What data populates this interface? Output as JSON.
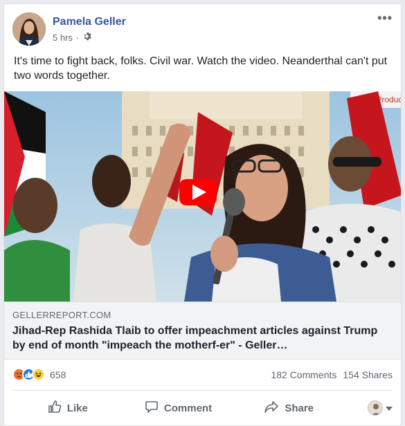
{
  "post": {
    "author": "Pamela Geller",
    "time": "5 hrs",
    "privacy_icon": "gear-icon",
    "text": "It's time to fight back, folks. Civil war. Watch the video. Neanderthal can't put two words together."
  },
  "media": {
    "watermark": "vald Production",
    "play_icon": "youtube-play-icon"
  },
  "link": {
    "domain": "GELLERREPORT.COM",
    "headline": "Jihad-Rep Rashida Tlaib to offer impeachment articles against Trump by end of month \"impeach the motherf-er\" - Geller…"
  },
  "stats": {
    "reaction_icons": [
      "angry-icon",
      "like-icon",
      "haha-icon"
    ],
    "reaction_count": "658",
    "comments": "182 Comments",
    "shares": "154 Shares"
  },
  "actions": {
    "like": "Like",
    "comment": "Comment",
    "share": "Share"
  },
  "colors": {
    "link_blue": "#385898",
    "youtube_red": "#ff0000",
    "like_blue": "#1877f2",
    "angry_orange": "#f0712c"
  }
}
